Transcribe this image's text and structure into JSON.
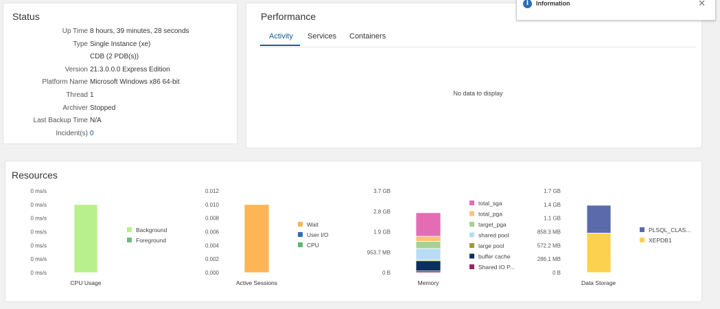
{
  "status": {
    "title": "Status",
    "rows": [
      {
        "label": "Up Time",
        "value": "8 hours, 39 minutes, 28 seconds"
      },
      {
        "label": "Type",
        "value": "Single Instance (xe)"
      },
      {
        "label": "",
        "value": "CDB (2 PDB(s))"
      },
      {
        "label": "Version",
        "value": "21.3.0.0.0 Express Edition"
      },
      {
        "label": "Platform Name",
        "value": "Microsoft Windows x86 64-bit"
      },
      {
        "label": "Thread",
        "value": "1"
      },
      {
        "label": "Archiver",
        "value": "Stopped"
      },
      {
        "label": "Last Backup Time",
        "value": "N/A"
      },
      {
        "label": "Incident(s)",
        "value": "0"
      }
    ]
  },
  "performance": {
    "title": "Performance",
    "tabs": [
      "Activity",
      "Services",
      "Containers"
    ],
    "active_tab": "Activity",
    "no_data": "No data to display"
  },
  "info_banner": {
    "label": "Information",
    "icon": "info-icon",
    "close_icon": "close-icon"
  },
  "resources": {
    "title": "Resources"
  },
  "chart_data": [
    {
      "type": "bar",
      "xlabel": "CPU Usage",
      "stacked": true,
      "yticks": [
        "0 ms/s",
        "0 ms/s",
        "0 ms/s",
        "0 ms/s",
        "0 ms/s",
        "0 ms/s",
        "0 ms/s"
      ],
      "ylim": [
        0,
        6
      ],
      "series": [
        {
          "name": "Background",
          "color": "#b9f08e",
          "value": 5
        },
        {
          "name": "Foreground",
          "color": "#6bbf7f",
          "value": 0
        }
      ]
    },
    {
      "type": "bar",
      "xlabel": "Active Sessions",
      "stacked": true,
      "yticks": [
        "0.000",
        "0.002",
        "0.004",
        "0.006",
        "0.008",
        "0.010",
        "0.012"
      ],
      "ylim": [
        0,
        0.012
      ],
      "series": [
        {
          "name": "Wait",
          "color": "#fdb555",
          "value": 0.01
        },
        {
          "name": "User I/O",
          "color": "#2f6fb6",
          "value": 0
        },
        {
          "name": "CPU",
          "color": "#5cb870",
          "value": 0
        }
      ]
    },
    {
      "type": "bar",
      "xlabel": "Memory",
      "stacked": true,
      "yticks": [
        "0 B",
        "953.7 MB",
        "1.9 GB",
        "2.8 GB",
        "3.7 GB"
      ],
      "ylim": [
        0,
        4
      ],
      "series": [
        {
          "name": "total_sga",
          "color": "#e46cb4",
          "value": 1.15
        },
        {
          "name": "total_pga",
          "color": "#fdc081",
          "value": 0.25
        },
        {
          "name": "target_pga",
          "color": "#a8d18c",
          "value": 0.35
        },
        {
          "name": "shared pool",
          "color": "#b7dcf3",
          "value": 0.55
        },
        {
          "name": "large pool",
          "color": "#9a9b3d",
          "value": 0.05
        },
        {
          "name": "buffer cache",
          "color": "#0c2f5e",
          "value": 0.5
        },
        {
          "name": "Shared IO P...",
          "color": "#8c2a5e",
          "value": 0.08
        }
      ]
    },
    {
      "type": "bar",
      "xlabel": "Data Storage",
      "stacked": true,
      "yticks": [
        "0 B",
        "286.1 MB",
        "572.2 MB",
        "858.3 MB",
        "1.1 GB",
        "1.4 GB",
        "1.7 GB"
      ],
      "ylim": [
        0,
        1716.6
      ],
      "series": [
        {
          "name": "PLSQL_CLAS...",
          "color": "#5b6aaa",
          "value": 585
        },
        {
          "name": "XEPDB1",
          "color": "#fcd14f",
          "value": 830
        }
      ]
    }
  ]
}
